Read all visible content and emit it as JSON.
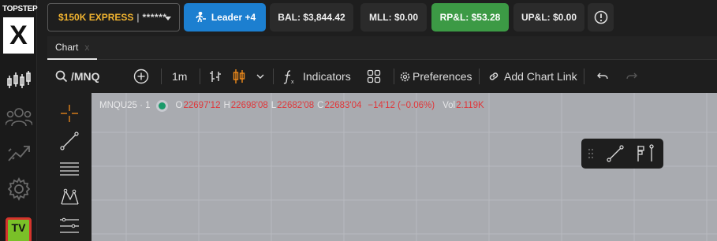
{
  "brand": {
    "logo_text": "TOPSTEP",
    "logo_mark": "X"
  },
  "rail": {
    "icons": [
      "candles-icon",
      "users-icon",
      "trend-icon",
      "settings-icon"
    ],
    "tv_badge": "TV"
  },
  "header": {
    "account": {
      "name": "$150K EXPRESS",
      "separator": "|",
      "masked": "******"
    },
    "leader_button": "Leader +4",
    "stats": {
      "bal": "BAL: $3,844.42",
      "mll": "MLL: $0.00",
      "rpl": "RP&L: $53.28",
      "upl": "UP&L: $0.00"
    },
    "colors": {
      "account_name": "#f0b330",
      "leader": "#1c7fd0",
      "rpl_positive": "#3c9a45"
    }
  },
  "tabs": [
    {
      "label": "Chart",
      "close": "x"
    }
  ],
  "toolbar": {
    "symbol": "/MNQ",
    "interval": "1m",
    "indicators_label": "Indicators",
    "preferences_label": "Preferences",
    "add_chart_link_label": "Add Chart Link"
  },
  "legend": {
    "symbol": "MNQU25 · 1",
    "open_label": "O",
    "open": "22697'12",
    "high_label": "H",
    "high": "22698'08",
    "low_label": "L",
    "low": "22682'08",
    "close_label": "C",
    "close": "22683'04",
    "change": "−14'12 (−0.06%)",
    "vol_label": "Vol",
    "vol": "2.119K",
    "colors": {
      "down": "#e0373a",
      "status_dot": "#1a9a6a"
    }
  }
}
